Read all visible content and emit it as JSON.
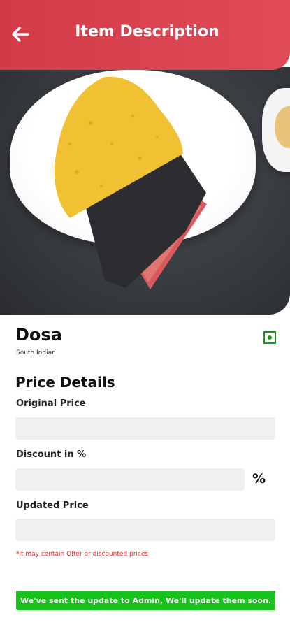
{
  "header": {
    "title": "Item Description",
    "accent_color": "#d23a48"
  },
  "item": {
    "name": "Dosa",
    "cuisine": "South Indian",
    "diet_marker_icon": "veg-indicator-icon"
  },
  "price_details": {
    "title": "Price Details",
    "original_price_label": "Original Price",
    "original_price_value": "",
    "discount_label": "Discount in %",
    "discount_value": "",
    "discount_unit": "%",
    "updated_price_label": "Updated Price",
    "updated_price_value": "",
    "note": "*it may contain Offer or discounted prices"
  },
  "toast": {
    "message": "We've sent the update to Admin, We'll update them soon."
  }
}
